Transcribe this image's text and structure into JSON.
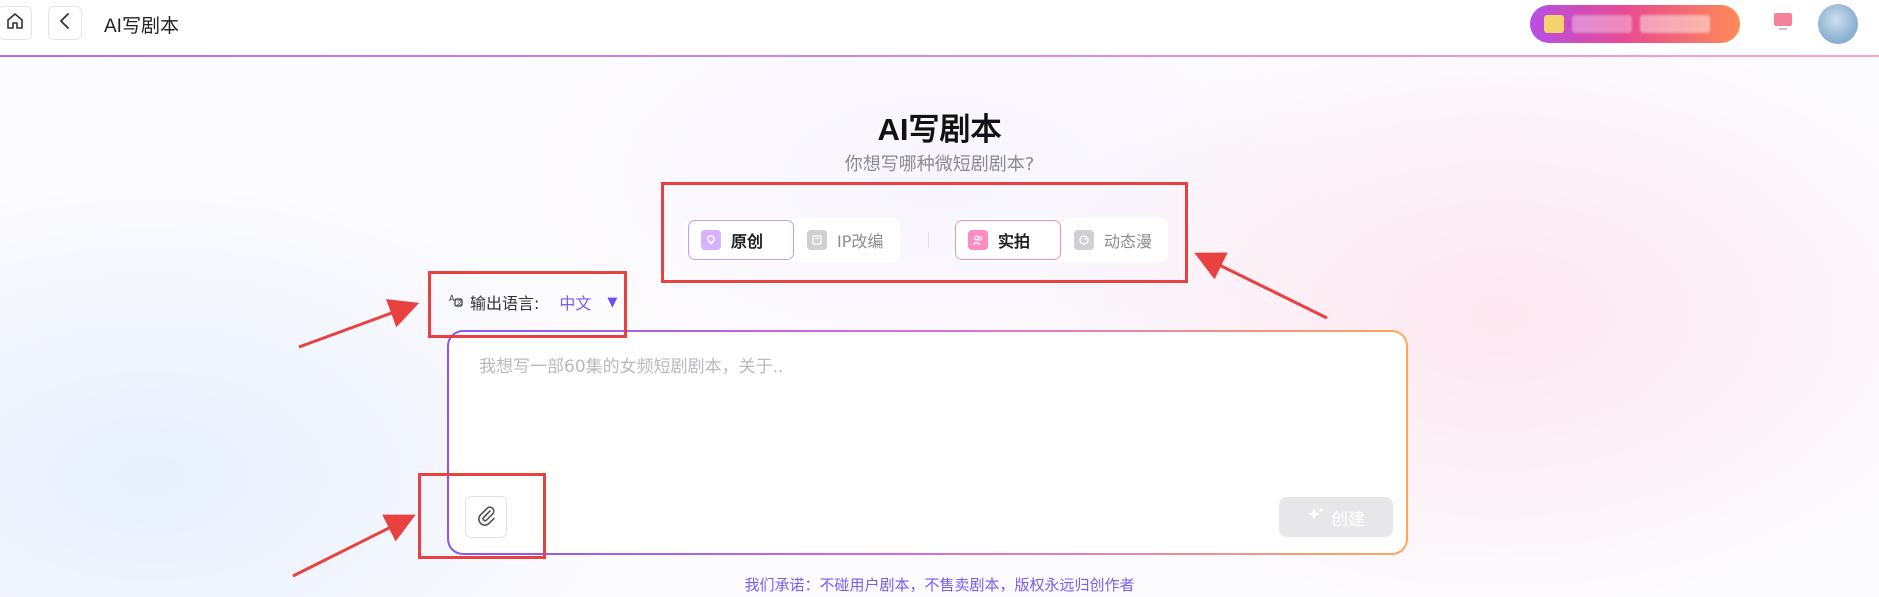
{
  "header": {
    "title": "AI写剧本",
    "home_icon": "home-icon",
    "back_icon": "back-arrow-icon"
  },
  "hero": {
    "title": "AI写剧本",
    "subtitle": "你想写哪种微短剧剧本?"
  },
  "script_type": {
    "options": [
      {
        "label": "原创",
        "icon": "lightbulb-icon",
        "active": true
      },
      {
        "label": "IP改编",
        "icon": "book-icon",
        "active": false
      }
    ]
  },
  "media_type": {
    "options": [
      {
        "label": "实拍",
        "icon": "people-icon",
        "active": true
      },
      {
        "label": "动态漫",
        "icon": "animation-icon",
        "active": false
      }
    ]
  },
  "language": {
    "label": "输出语言:",
    "value": "中文"
  },
  "editor": {
    "placeholder": "我想写一部60集的女频短剧剧本，关于..",
    "create_label": "创建"
  },
  "footer": {
    "promise": "我们承诺：不碰用户剧本，不售卖剧本，版权永远归创作者"
  },
  "colors": {
    "accent_purple": "#7b5cf0",
    "annotation_red": "#e9413f",
    "gradient_start": "#8a55f0",
    "gradient_end": "#ffa758"
  }
}
